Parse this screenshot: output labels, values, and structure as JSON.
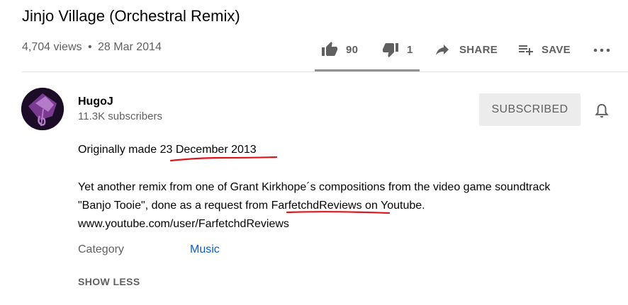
{
  "video": {
    "title": "Jinjo Village (Orchestral Remix)",
    "views": "4,704 views",
    "separator": "•",
    "date": "28 Mar 2014"
  },
  "actions": {
    "like_icon": "thumbs-up-icon",
    "like_count": "90",
    "dislike_icon": "thumbs-down-icon",
    "dislike_count": "1",
    "share_icon": "share-arrow-icon",
    "share_label": "SHARE",
    "save_icon": "playlist-add-icon",
    "save_label": "SAVE",
    "more_icon": "more-horizontal-icon",
    "like_ratio": 0.989
  },
  "channel": {
    "name": "HugoJ",
    "subscribers": "11.3K subscribers",
    "subscribe_label": "SUBSCRIBED",
    "bell_icon": "bell-icon"
  },
  "description": {
    "line1_prefix": "Originally made ",
    "line1_date": "23 December 2013",
    "line2": "Yet another remix from one of Grant Kirkhope´s compositions from the video game soundtrack",
    "line3_prefix": "\"Banjo Tooie\", done as a request from ",
    "line3_link": "FarfetchdReviews",
    "line3_suffix": " on Youtube.",
    "line4": "www.youtube.com/user/FarfetchdReviews"
  },
  "metadata": {
    "category_label": "Category",
    "category_value": "Music"
  },
  "show_less_label": "SHOW LESS",
  "colors": {
    "text_primary": "#030303",
    "text_secondary": "#606060",
    "link_blue": "#065fd4",
    "annotation_red": "#e0141e",
    "subscribed_bg": "#ececec"
  }
}
